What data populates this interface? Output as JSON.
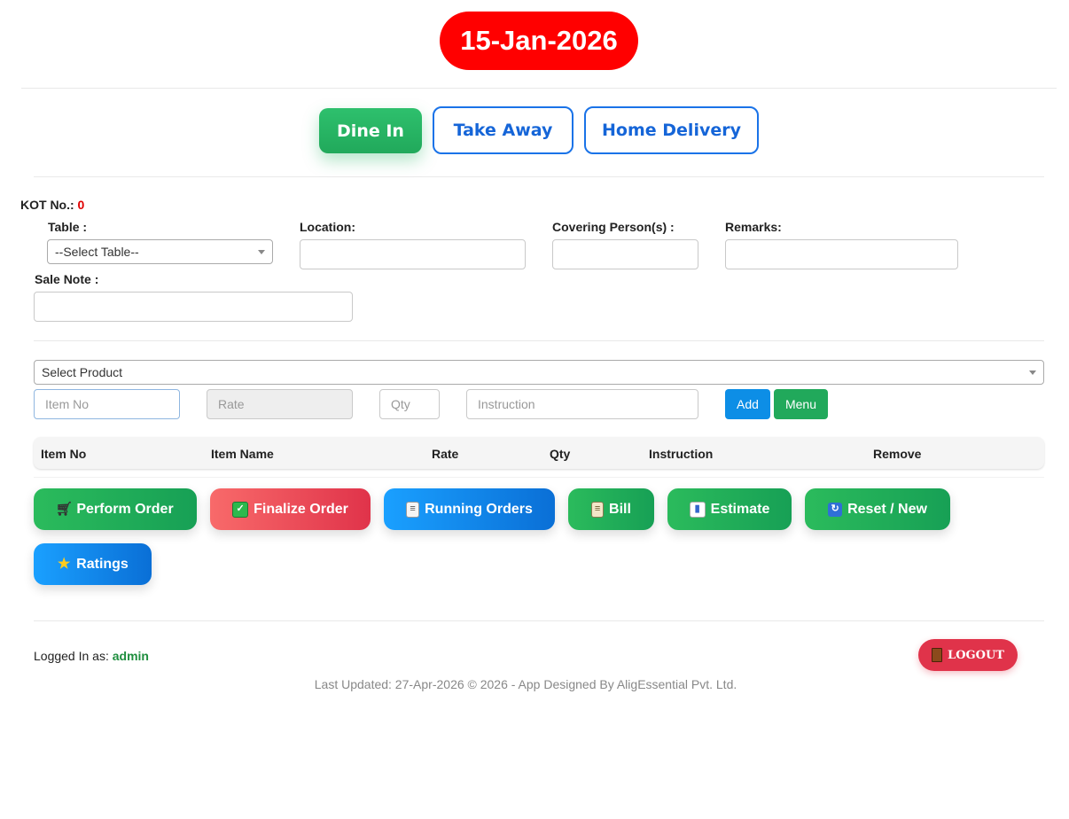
{
  "header": {
    "date": "15-Jan-2026"
  },
  "modes": {
    "dine_in": "Dine In",
    "take_away": "Take Away",
    "home_delivery": "Home Delivery"
  },
  "kot": {
    "label": "KOT No.:",
    "value": "0"
  },
  "form": {
    "table_label": "Table :",
    "table_selected": "--Select Table--",
    "location_label": "Location:",
    "covering_label": "Covering Person(s) :",
    "remarks_label": "Remarks:",
    "sale_note_label": "Sale Note :"
  },
  "product": {
    "select_placeholder": "Select Product",
    "item_no_placeholder": "Item No",
    "rate_placeholder": "Rate",
    "qty_placeholder": "Qty",
    "instruction_placeholder": "Instruction",
    "add_label": "Add",
    "menu_label": "Menu"
  },
  "table": {
    "columns": [
      "Item No",
      "Item Name",
      "Rate",
      "Qty",
      "Instruction",
      "Remove"
    ]
  },
  "actions": {
    "perform_order": "Perform Order",
    "finalize_order": "Finalize Order",
    "running_orders": "Running Orders",
    "bill": "Bill",
    "estimate": "Estimate",
    "reset_new": "Reset / New",
    "ratings": "Ratings"
  },
  "icons": {
    "perform_order": "shopping-cart-icon",
    "finalize_order": "check-mark-icon",
    "running_orders": "clipboard-icon",
    "bill": "scroll-icon",
    "estimate": "bar-chart-icon",
    "reset_new": "refresh-icon",
    "ratings": "star-icon",
    "logout": "door-icon"
  },
  "user": {
    "logged_in_label": "Logged In as:",
    "username": "admin",
    "logout_label": "LOGOUT"
  },
  "footer": {
    "note": "Last Updated: 27-Apr-2026 © 2026 - App Designed By AligEssential Pvt. Ltd."
  },
  "colors": {
    "date_bg": "#ff0000",
    "active_mode": "#27b463",
    "mode_border": "#1a73e8",
    "kot_value": "#e00000",
    "username": "#1e8e3e",
    "logout_bg": "#e0334a"
  }
}
